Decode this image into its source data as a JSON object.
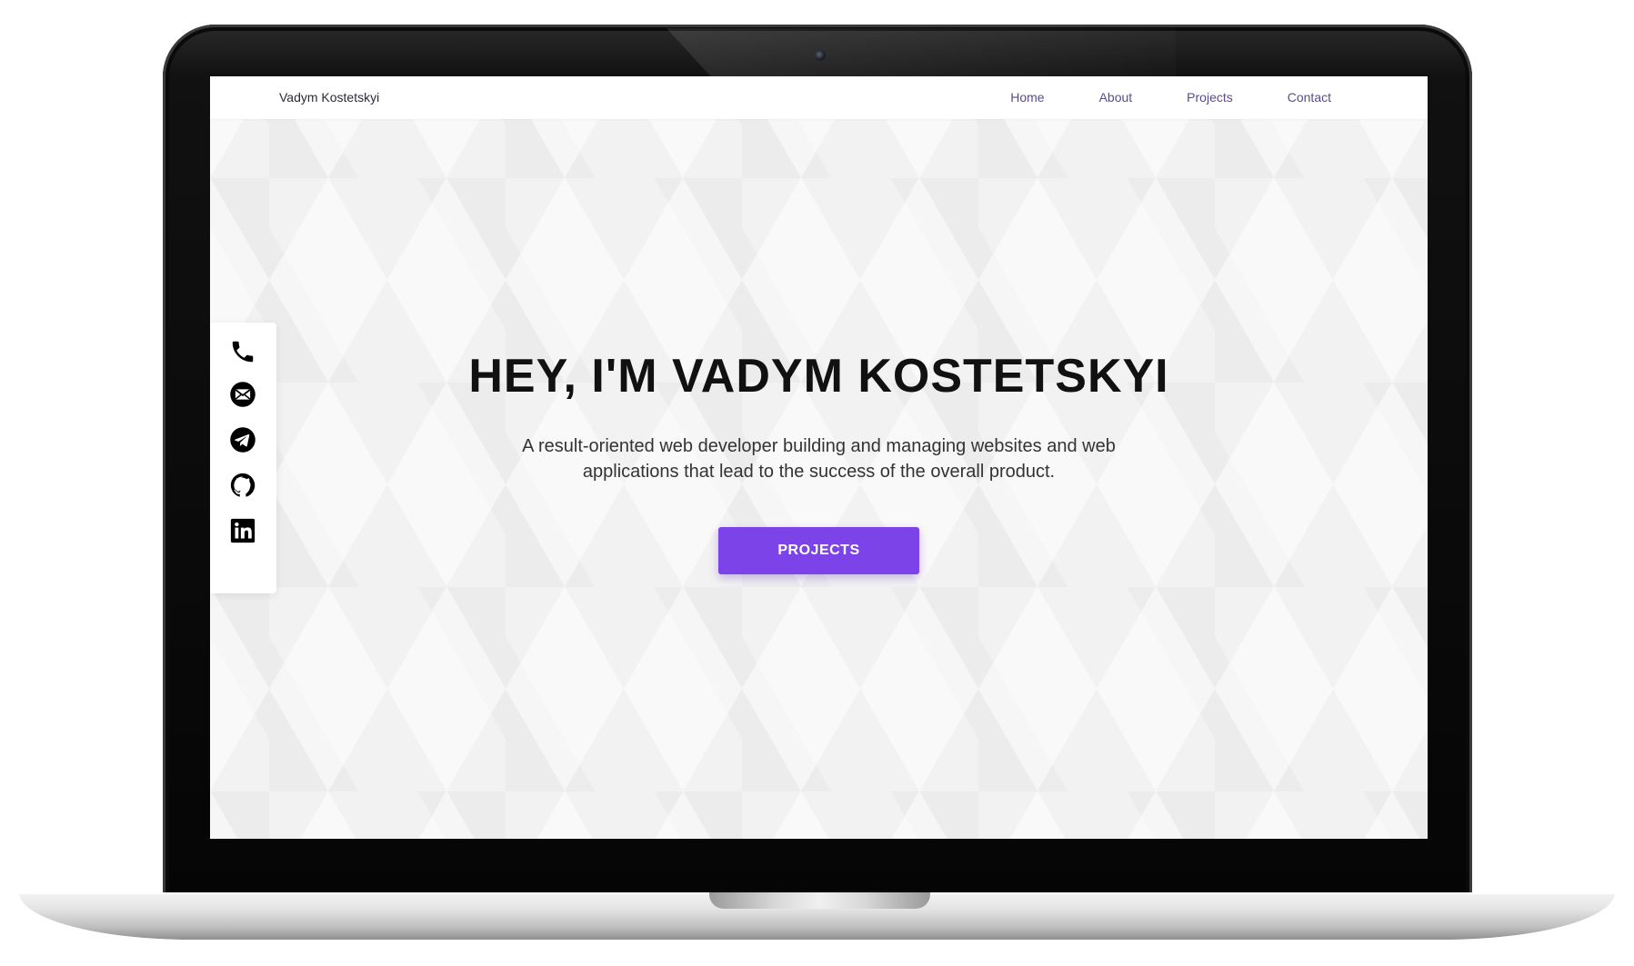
{
  "site": {
    "brand": "Vadym Kostetskyi"
  },
  "nav": {
    "items": [
      {
        "label": "Home"
      },
      {
        "label": "About"
      },
      {
        "label": "Projects"
      },
      {
        "label": "Contact"
      }
    ]
  },
  "social": {
    "items": [
      {
        "icon": "phone-icon"
      },
      {
        "icon": "mail-icon"
      },
      {
        "icon": "telegram-icon"
      },
      {
        "icon": "github-icon"
      },
      {
        "icon": "linkedin-icon"
      }
    ]
  },
  "hero": {
    "title": "HEY, I'M VADYM KOSTETSKYI",
    "description": "A result-oriented web developer building and managing websites and web applications that lead to the success of the overall product.",
    "button_label": "PROJECTS"
  },
  "colors": {
    "accent": "#7b43e8",
    "nav_link": "#5b4a8f",
    "background": "#f2f2f2"
  }
}
